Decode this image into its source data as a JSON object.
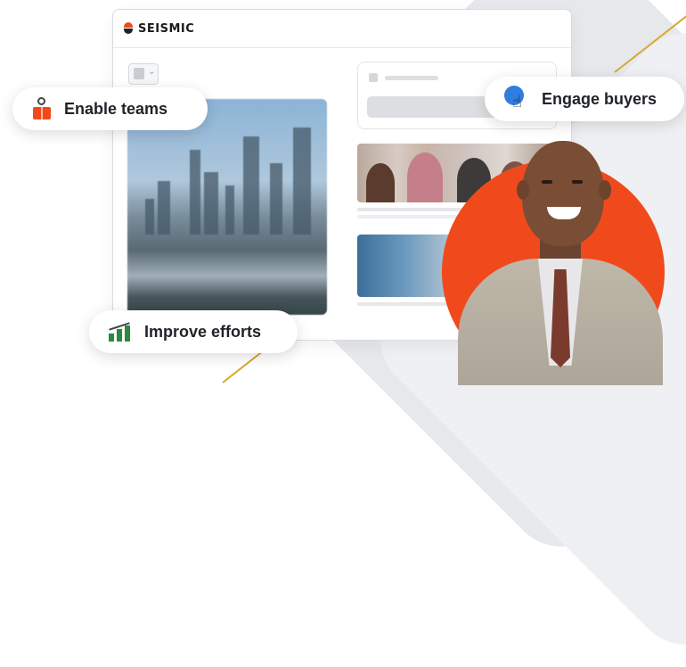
{
  "brand": {
    "name": "SEISMIC"
  },
  "pills": {
    "enable_teams": "Enable teams",
    "engage_buyers": "Engage buyers",
    "improve_efforts": "Improve efforts"
  },
  "icons": {
    "enable_teams": "person-book-icon",
    "engage_buyers": "pointer-hand-icon",
    "improve_efforts": "bar-chart-trend-icon"
  },
  "colors": {
    "accent": "#f04a1c",
    "cursor_blue": "#2f7de1",
    "chart_green": "#2b8a3e",
    "line_gold": "#d8a82a"
  }
}
